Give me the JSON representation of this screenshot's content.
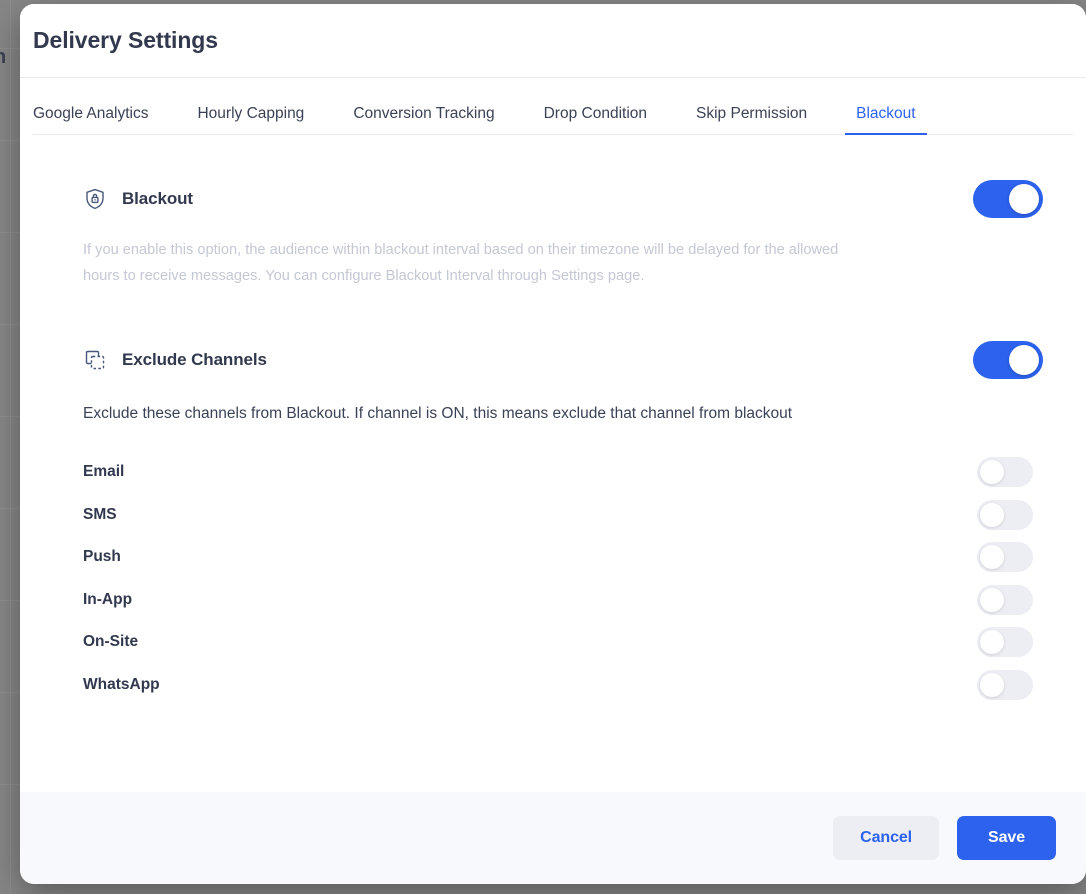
{
  "backdrop": {
    "partial_text": "n"
  },
  "modal": {
    "title": "Delivery Settings",
    "tabs": [
      {
        "label": "Google Analytics",
        "active": false
      },
      {
        "label": "Hourly Capping",
        "active": false
      },
      {
        "label": "Conversion Tracking",
        "active": false
      },
      {
        "label": "Drop Condition",
        "active": false
      },
      {
        "label": "Skip Permission",
        "active": false
      },
      {
        "label": "Blackout",
        "active": true
      }
    ],
    "blackout": {
      "icon": "shield-lock-icon",
      "label": "Blackout",
      "enabled": true,
      "toggle_state": "on",
      "description": "If you enable this option, the audience within blackout interval based on their timezone will be delayed for the allowed hours to receive messages. You can configure Blackout Interval through Settings page."
    },
    "exclude_channels": {
      "icon": "overlapping-squares-icon",
      "label": "Exclude Channels",
      "enabled": true,
      "toggle_state": "on",
      "description": "Exclude these channels from Blackout. If channel is ON, this means exclude that channel from blackout",
      "items": [
        {
          "label": "Email",
          "enabled": false,
          "toggle_state": "off"
        },
        {
          "label": "SMS",
          "enabled": false,
          "toggle_state": "off"
        },
        {
          "label": "Push",
          "enabled": false,
          "toggle_state": "off"
        },
        {
          "label": "In-App",
          "enabled": false,
          "toggle_state": "off"
        },
        {
          "label": "On-Site",
          "enabled": false,
          "toggle_state": "off"
        },
        {
          "label": "WhatsApp",
          "enabled": false,
          "toggle_state": "off"
        }
      ]
    },
    "footer": {
      "cancel_label": "Cancel",
      "save_label": "Save"
    }
  },
  "colors": {
    "accent": "#2c62ee",
    "title_text": "#32394e",
    "muted_text": "#c3c8d4",
    "toggle_off": "#eceef3",
    "footer_bg": "#f8f9fc",
    "border": "#e7eaee"
  }
}
